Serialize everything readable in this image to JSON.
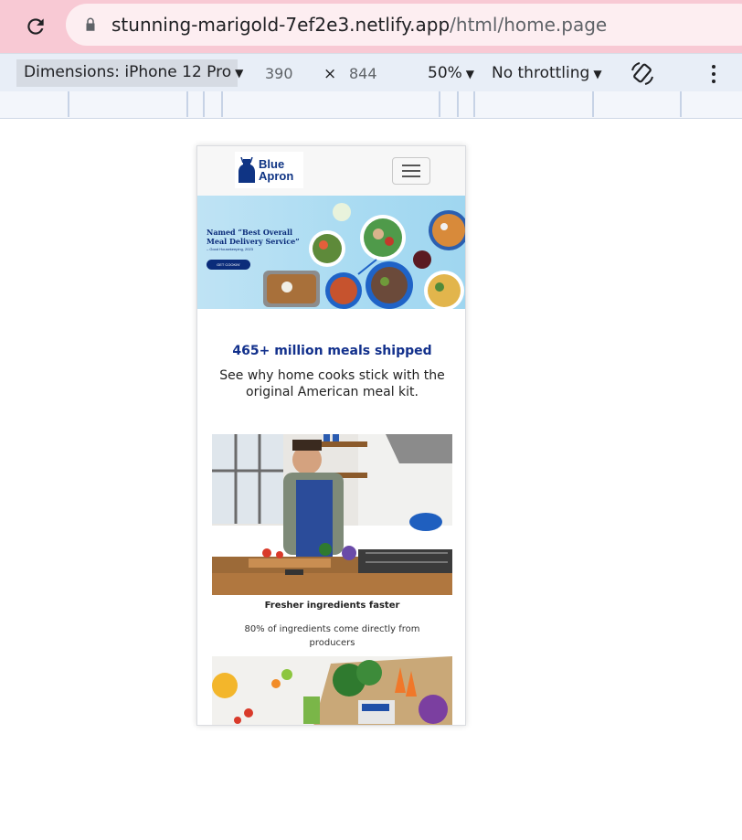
{
  "browser": {
    "url_host": "stunning-marigold-7ef2e3.netlify.app",
    "url_path": "/html/home.page"
  },
  "devtools": {
    "dimensions_label": "Dimensions: iPhone 12 Pro",
    "width_value": "390",
    "times_sign": "×",
    "height_value": "844",
    "zoom_label": "50%",
    "throttling_label": "No throttling"
  },
  "site": {
    "logo_text": "Blue\nApron",
    "hero": {
      "headline": "Named “Best Overall\nMeal Delivery Service”",
      "source": "– Good Housekeeping, 2023",
      "button_label": "GET COOKIN'"
    },
    "stat_title": "465+ million meals shipped",
    "stat_subtitle": "See why home cooks stick with the original American meal kit.",
    "feature": {
      "title": "Fresher ingredients faster",
      "text": "80% of ingredients come directly from producers"
    }
  },
  "colors": {
    "brand_blue": "#12308c",
    "browser_bar": "#f8c9d4"
  },
  "icons": [
    "reload-icon",
    "lock-icon",
    "rotate-icon",
    "more-vert-icon",
    "hamburger-icon",
    "apron-logo-icon"
  ]
}
